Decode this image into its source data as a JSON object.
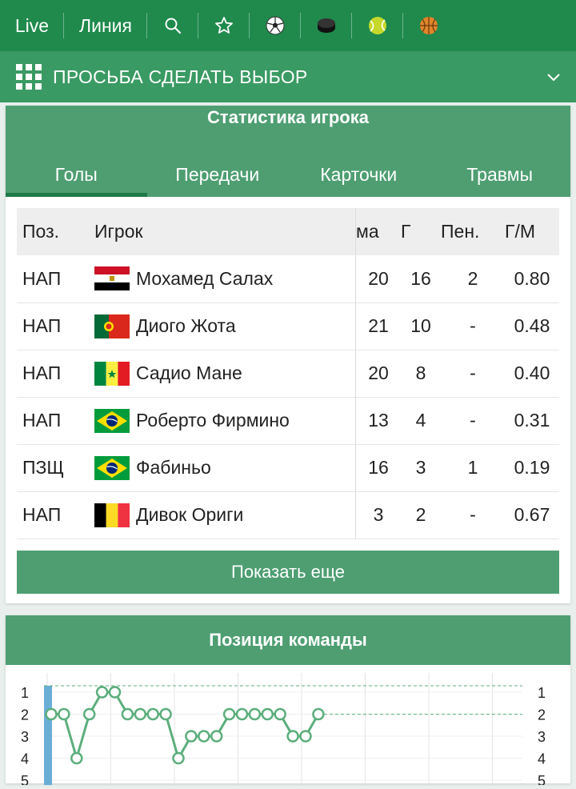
{
  "topnav": {
    "live": "Live",
    "line": "Линия",
    "icons": [
      "search-icon",
      "star-icon",
      "football-icon",
      "hockey-puck-icon",
      "tennis-ball-icon",
      "basketball-icon"
    ]
  },
  "selectbar": {
    "title": "ПРОСЬБА СДЕЛАТЬ ВЫБОР"
  },
  "player_stats": {
    "title": "Статистика игрока",
    "tabs": [
      "Голы",
      "Передачи",
      "Карточки",
      "Травмы"
    ],
    "active_tab": 0,
    "columns": [
      "Поз.",
      "Игрок",
      "ма",
      "Г",
      "Пен.",
      "Г/М"
    ],
    "rows": [
      {
        "pos": "НАП",
        "player": "Мохамед Салах",
        "flag": "egypt",
        "matches": "20",
        "goals": "16",
        "pen": "2",
        "gpm": "0.80"
      },
      {
        "pos": "НАП",
        "player": "Диого Жота",
        "flag": "portugal",
        "matches": "21",
        "goals": "10",
        "pen": "-",
        "gpm": "0.48"
      },
      {
        "pos": "НАП",
        "player": "Садио Мане",
        "flag": "senegal",
        "matches": "20",
        "goals": "8",
        "pen": "-",
        "gpm": "0.40"
      },
      {
        "pos": "НАП",
        "player": "Роберто Фирмино",
        "flag": "brazil",
        "matches": "13",
        "goals": "4",
        "pen": "-",
        "gpm": "0.31"
      },
      {
        "pos": "ПЗЩ",
        "player": "Фабиньо",
        "flag": "brazil",
        "matches": "16",
        "goals": "3",
        "pen": "1",
        "gpm": "0.19"
      },
      {
        "pos": "НАП",
        "player": "Дивок Ориги",
        "flag": "belgium",
        "matches": "3",
        "goals": "2",
        "pen": "-",
        "gpm": "0.67"
      }
    ],
    "show_more": "Показать еще"
  },
  "team_position": {
    "title": "Позиция команды",
    "colors": {
      "line": "#5cae7c",
      "accent": "#6aaed6"
    }
  },
  "chart_data": {
    "type": "line",
    "ylabels": [
      "1",
      "2",
      "3",
      "4",
      "5"
    ],
    "y_reversed": true,
    "series": [
      {
        "values": [
          2,
          2,
          4,
          2,
          1,
          1,
          2,
          2,
          2,
          2,
          4,
          3,
          3,
          3,
          2,
          2,
          2,
          2,
          2,
          3,
          3,
          2
        ]
      }
    ],
    "current_position": 2
  }
}
